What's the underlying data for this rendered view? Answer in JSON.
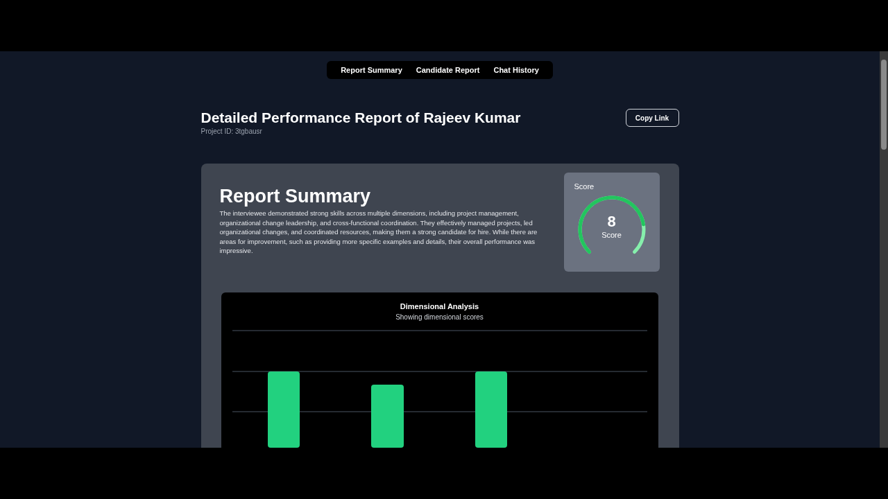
{
  "tabs": [
    {
      "label": "Report Summary"
    },
    {
      "label": "Candidate Report"
    },
    {
      "label": "Chat History"
    }
  ],
  "header": {
    "title": "Detailed Performance Report of Rajeev Kumar",
    "project_id": "Project ID: 3tgbausr",
    "copy_button": "Copy Link"
  },
  "summary": {
    "heading": "Report Summary",
    "text": "The interviewee demonstrated strong skills across multiple dimensions, including project management, organizational change leadership, and cross-functional coordination. They effectively managed projects, led organizational changes, and coordinated resources, making them a strong candidate for hire. While there are areas for improvement, such as providing more specific examples and details, their overall performance was impressive."
  },
  "score": {
    "label": "Score",
    "value": "8",
    "caption": "Score"
  },
  "chart": {
    "title": "Dimensional Analysis",
    "subtitle": "Showing dimensional scores"
  }
}
